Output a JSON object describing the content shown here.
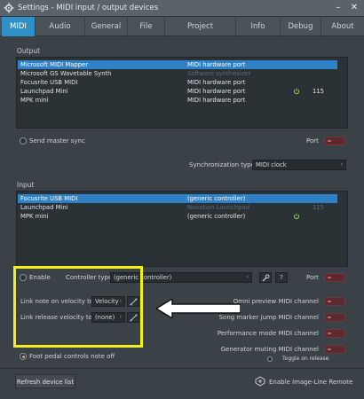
{
  "window": {
    "title": "Settings - MIDI input / output devices",
    "minimize": "–",
    "close": "✕"
  },
  "tabs": [
    {
      "label": "MIDI",
      "active": true
    },
    {
      "label": "Audio"
    },
    {
      "label": "General"
    },
    {
      "label": "File"
    },
    {
      "label": "Project"
    },
    {
      "label": "Info"
    },
    {
      "label": "Debug"
    },
    {
      "label": "About"
    }
  ],
  "output": {
    "title": "Output",
    "devices": [
      {
        "name": "Microsoft MIDI Mapper",
        "type": "MIDI hardware port",
        "port": "",
        "selected": true
      },
      {
        "name": "Microsoft GS Wavetable Synth",
        "type": "Software synthesizer",
        "port": ""
      },
      {
        "name": "Focusrite USB MIDI",
        "type": "MIDI hardware port",
        "port": ""
      },
      {
        "name": "Launchpad Mini",
        "type": "MIDI hardware port",
        "port": "115",
        "power": true
      },
      {
        "name": "MPK mini",
        "type": "MIDI hardware port",
        "port": ""
      }
    ],
    "send_master_sync": "Send master sync",
    "port_label": "Port",
    "sync_type_label": "Synchronization type",
    "sync_type_value": "MIDI clock"
  },
  "input": {
    "title": "Input",
    "devices": [
      {
        "name": "Focusrite USB MIDI",
        "type": "(generic controller)",
        "port": "",
        "selected": true
      },
      {
        "name": "Launchpad Mini",
        "type": "Novation Launchpad",
        "port": "115",
        "dim": true
      },
      {
        "name": "MPK mini",
        "type": "(generic controller)",
        "port": "",
        "power": true
      }
    ],
    "enable_label": "Enable",
    "controller_type_label": "Controller type",
    "controller_type_value": "(generic controller)",
    "help_label": "?",
    "port_label": "Port",
    "link_velocity_label": "Link note on velocity to",
    "link_velocity_value": "Velocity",
    "link_release_label": "Link release velocity to",
    "link_release_value": "(none)",
    "omni_preview": "Omni preview MIDI channel",
    "song_marker_jump": "Song marker jump MIDI channel",
    "performance_mode": "Performance mode MIDI channel",
    "generator_muting": "Generator muting MIDI channel",
    "toggle_on_release": "Toggle on release",
    "foot_pedal": "Foot pedal controls note off"
  },
  "footer": {
    "refresh_label": "Refresh device list",
    "image_line_remote": "Enable Image-Line Remote"
  },
  "colors": {
    "accent": "#2f90c7",
    "highlight": "#f2f01a",
    "toggle": "#d05a66"
  }
}
